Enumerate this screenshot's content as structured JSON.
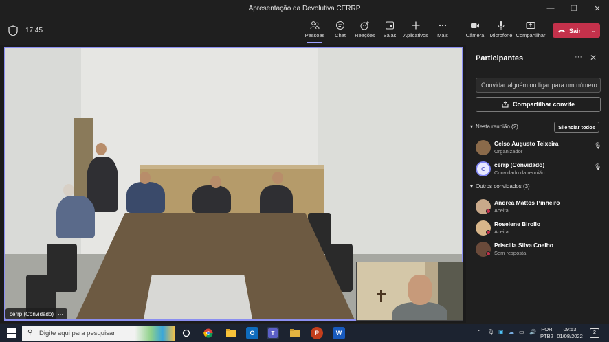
{
  "window": {
    "title": "Apresentação da Devolutiva CERRP",
    "controls": [
      "minimize",
      "restore",
      "close"
    ]
  },
  "toolbar": {
    "clock": "17:45",
    "items": [
      {
        "label": "Pessoas",
        "icon": "people-icon",
        "active": true
      },
      {
        "label": "Chat",
        "icon": "chat-icon"
      },
      {
        "label": "Reações",
        "icon": "reactions-icon"
      },
      {
        "label": "Salas",
        "icon": "rooms-icon"
      },
      {
        "label": "Aplicativos",
        "icon": "apps-icon"
      },
      {
        "label": "Mais",
        "icon": "more-icon"
      },
      {
        "label": "Câmera",
        "icon": "camera-icon"
      },
      {
        "label": "Microfone",
        "icon": "microphone-icon"
      },
      {
        "label": "Compartilhar",
        "icon": "share-icon"
      }
    ],
    "leave_label": "Sair",
    "leave_color": "#c4314b"
  },
  "stage": {
    "main_video_label": "cerrp (Convidado)",
    "active_border_color": "#8b8ff0"
  },
  "panel": {
    "title": "Participantes",
    "invite_placeholder": "Convidar alguém ou ligar para um número",
    "share_invite_label": "Compartilhar convite",
    "in_meeting_header": "Nesta reunião (2)",
    "mute_all_label": "Silenciar todos",
    "in_meeting": [
      {
        "name": "Celso Augusto Teixeira",
        "role": "Organizador",
        "mic": true
      },
      {
        "name": "cerrp (Convidado)",
        "role": "Convidado da reunião",
        "initial": "C",
        "mic": true
      }
    ],
    "others_header": "Outros convidados (3)",
    "others": [
      {
        "name": "Andrea Mattos Pinheiro",
        "status": "Aceita"
      },
      {
        "name": "Roselene Birollo",
        "status": "Aceita"
      },
      {
        "name": "Priscilla Silva Coelho",
        "status": "Sem resposta"
      }
    ]
  },
  "taskbar": {
    "search_placeholder": "Digite aqui para pesquisar",
    "language": "POR",
    "keyboard": "PTB2",
    "time": "09:53",
    "date": "01/08/2022",
    "notification_count": "2"
  }
}
